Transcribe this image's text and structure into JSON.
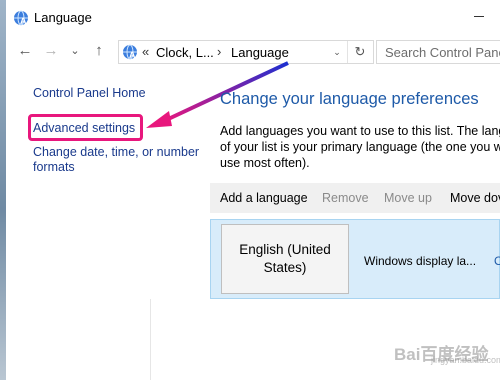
{
  "window": {
    "title": "Language",
    "icon": "control-panel-globe-icon"
  },
  "nav": {
    "back_icon": "back-arrow-icon",
    "forward_icon": "forward-arrow-icon",
    "recent_icon": "chevron-down-icon",
    "up_icon": "up-arrow-icon",
    "back_glyph": "←",
    "forward_glyph": "→",
    "recent_glyph": "⌄",
    "up_glyph": "↑"
  },
  "address": {
    "overflow": "«",
    "crumbs": [
      "Clock, L...",
      "Language"
    ],
    "separator": "›",
    "dropdown_glyph": "⌄",
    "refresh_glyph": "↻"
  },
  "search": {
    "placeholder": "Search Control Panel"
  },
  "sidebar": {
    "items": [
      {
        "label": "Control Panel Home"
      },
      {
        "label": "Advanced settings"
      },
      {
        "label_line1": "Change date, time, or number",
        "label_line2": "formats"
      }
    ]
  },
  "main": {
    "heading": "Change your language preferences",
    "desc_line1": "Add languages you want to use to this list. The langua",
    "desc_line2": "of your list is your primary language (the one you want",
    "desc_line3": "use most often).",
    "toolbar": {
      "add": "Add a language",
      "remove": "Remove",
      "move_up": "Move up",
      "move_down": "Move dov"
    },
    "language": {
      "name_line1": "English (United",
      "name_line2": "States)",
      "status": "Windows display la...",
      "options": "Op"
    }
  },
  "annotation": {
    "highlight_color": "#e8177d",
    "arrow_colors": [
      "#1c2fd0",
      "#e8177d"
    ]
  },
  "watermark": {
    "text": "Bai百度经验",
    "sub": "jingyan.baidu.com"
  }
}
